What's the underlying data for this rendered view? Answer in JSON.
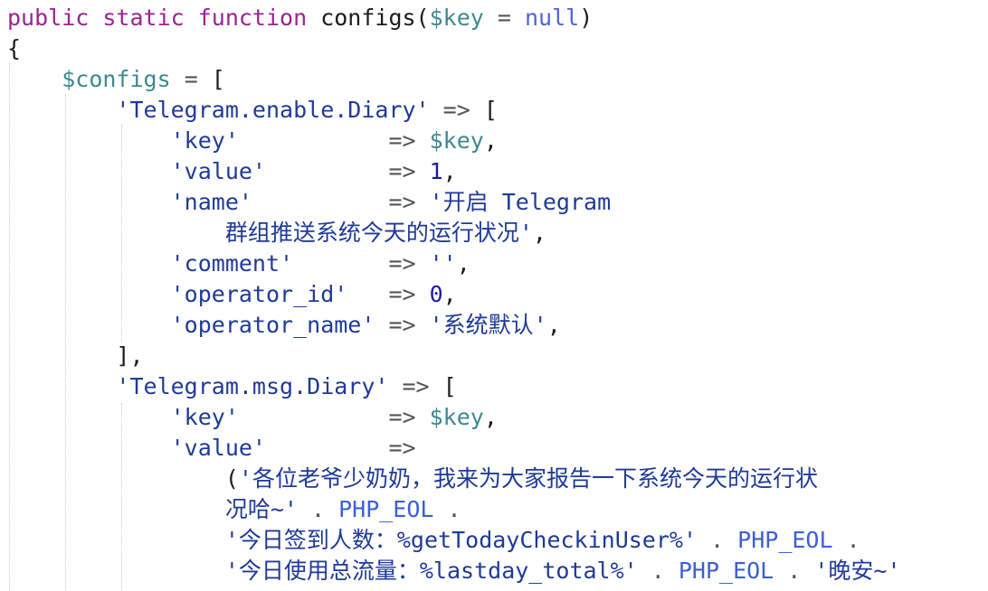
{
  "lines": [
    [
      [
        "kw",
        "public static function"
      ],
      [
        "plain",
        " configs("
      ],
      [
        "var",
        "$key"
      ],
      [
        "op",
        " = "
      ],
      [
        "nul",
        "null"
      ],
      [
        "plain",
        ")"
      ]
    ],
    [
      [
        "plain",
        "{"
      ]
    ],
    [
      [
        "plain",
        "    "
      ],
      [
        "var",
        "$configs"
      ],
      [
        "op",
        " = "
      ],
      [
        "plain",
        "["
      ]
    ],
    [
      [
        "plain",
        "        "
      ],
      [
        "str",
        "'Telegram.enable.Diary'"
      ],
      [
        "op",
        " => "
      ],
      [
        "plain",
        "["
      ]
    ],
    [
      [
        "plain",
        "            "
      ],
      [
        "str",
        "'key'"
      ],
      [
        "plain",
        "           "
      ],
      [
        "op",
        "=> "
      ],
      [
        "var",
        "$key"
      ],
      [
        "plain",
        ","
      ]
    ],
    [
      [
        "plain",
        "            "
      ],
      [
        "str",
        "'value'"
      ],
      [
        "plain",
        "         "
      ],
      [
        "op",
        "=> "
      ],
      [
        "num",
        "1"
      ],
      [
        "plain",
        ","
      ]
    ],
    [
      [
        "plain",
        "            "
      ],
      [
        "str",
        "'name'"
      ],
      [
        "plain",
        "          "
      ],
      [
        "op",
        "=> "
      ],
      [
        "str",
        "'开启 Telegram"
      ]
    ],
    [
      [
        "plain",
        "                "
      ],
      [
        "str",
        "群组推送系统今天的运行状况'"
      ],
      [
        "plain",
        ","
      ]
    ],
    [
      [
        "plain",
        "            "
      ],
      [
        "str",
        "'comment'"
      ],
      [
        "plain",
        "       "
      ],
      [
        "op",
        "=> "
      ],
      [
        "str",
        "''"
      ],
      [
        "plain",
        ","
      ]
    ],
    [
      [
        "plain",
        "            "
      ],
      [
        "str",
        "'operator_id'"
      ],
      [
        "plain",
        "   "
      ],
      [
        "op",
        "=> "
      ],
      [
        "num",
        "0"
      ],
      [
        "plain",
        ","
      ]
    ],
    [
      [
        "plain",
        "            "
      ],
      [
        "str",
        "'operator_name'"
      ],
      [
        "plain",
        " "
      ],
      [
        "op",
        "=> "
      ],
      [
        "str",
        "'系统默认'"
      ],
      [
        "plain",
        ","
      ]
    ],
    [
      [
        "plain",
        "        ],"
      ]
    ],
    [
      [
        "plain",
        "        "
      ],
      [
        "str",
        "'Telegram.msg.Diary'"
      ],
      [
        "op",
        " => "
      ],
      [
        "plain",
        "["
      ]
    ],
    [
      [
        "plain",
        "            "
      ],
      [
        "str",
        "'key'"
      ],
      [
        "plain",
        "           "
      ],
      [
        "op",
        "=> "
      ],
      [
        "var",
        "$key"
      ],
      [
        "plain",
        ","
      ]
    ],
    [
      [
        "plain",
        "            "
      ],
      [
        "str",
        "'value'"
      ],
      [
        "plain",
        "         "
      ],
      [
        "op",
        "=>"
      ]
    ],
    [
      [
        "plain",
        "                "
      ],
      [
        "plain",
        "("
      ],
      [
        "str",
        "'各位老爷少奶奶，我来为大家报告一下系统今天的运行状"
      ]
    ],
    [
      [
        "plain",
        "                "
      ],
      [
        "str",
        "况哈~'"
      ],
      [
        "op",
        " . "
      ],
      [
        "const",
        "PHP_EOL"
      ],
      [
        "op",
        " ."
      ]
    ],
    [
      [
        "plain",
        "                "
      ],
      [
        "str",
        "'今日签到人数：%getTodayCheckinUser%'"
      ],
      [
        "op",
        " . "
      ],
      [
        "const",
        "PHP_EOL"
      ],
      [
        "op",
        " ."
      ]
    ],
    [
      [
        "plain",
        "                "
      ],
      [
        "str",
        "'今日使用总流量：%lastday_total%'"
      ],
      [
        "op",
        " . "
      ],
      [
        "const",
        "PHP_EOL"
      ],
      [
        "op",
        " . "
      ],
      [
        "str",
        "'晚安~'"
      ]
    ]
  ]
}
